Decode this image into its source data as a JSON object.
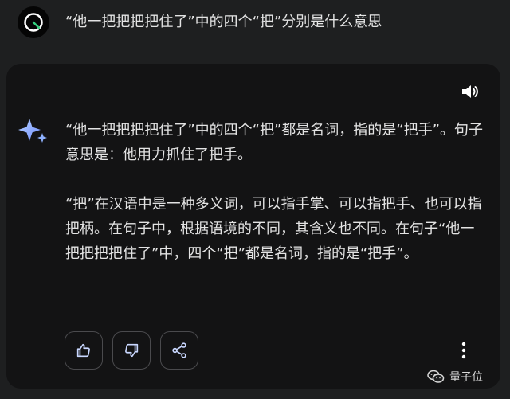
{
  "user": {
    "question": "“他一把把把把住了”中的四个“把”分别是什么意思"
  },
  "answer": {
    "paragraphs": [
      "“他一把把把把住了”中的四个“把”都是名词，指的是“把手”。句子意思是：他用力抓住了把手。",
      "“把”在汉语中是一种多义词，可以指手掌、可以指把手、也可以指把柄。在句子中，根据语境的不同，其含义也不同。在句子“他一把把把把住了”中，四个“把”都是名词，指的是“把手”。"
    ]
  },
  "icons": {
    "avatar": "loading-circle-icon",
    "speaker": "volume-icon",
    "assistant": "sparkle-icon",
    "thumbs_up": "thumbs-up-icon",
    "thumbs_down": "thumbs-down-icon",
    "share": "share-icon",
    "more": "more-vertical-icon",
    "watermark": "wechat-icon"
  },
  "colors": {
    "background": "#1e1f20",
    "card": "#131314",
    "text": "#e3e3e3",
    "accent_blue": "#6ea8fe",
    "button_border": "#4a4a4d",
    "avatar_ring_green": "#35d07f"
  },
  "watermark": {
    "label": "量子位"
  }
}
